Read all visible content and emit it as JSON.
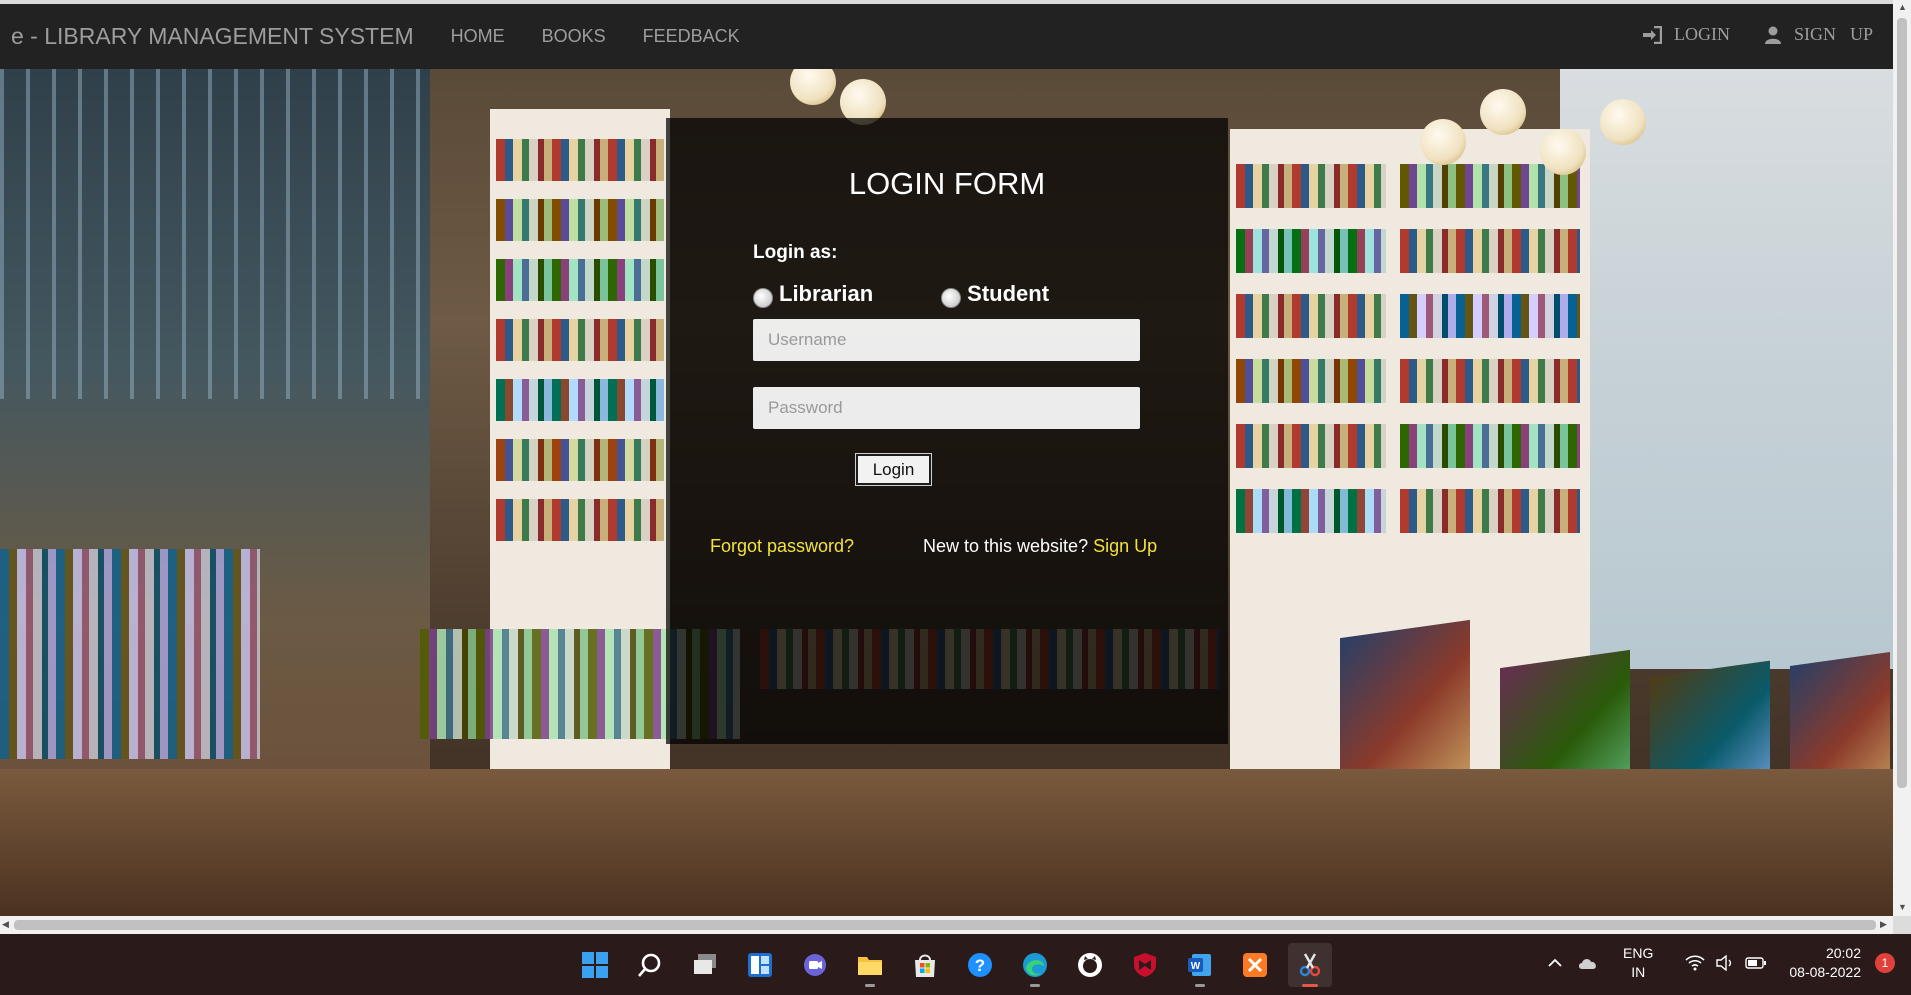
{
  "navbar": {
    "brand": "e - LIBRARY MANAGEMENT SYSTEM",
    "links": [
      "HOME",
      "BOOKS",
      "FEEDBACK"
    ],
    "login_label": "LOGIN",
    "signup_word1": "SIGN",
    "signup_word2": "UP"
  },
  "login_form": {
    "title": "LOGIN FORM",
    "login_as_label": "Login as:",
    "roles": [
      "Librarian",
      "Student"
    ],
    "username_placeholder": "Username",
    "password_placeholder": "Password",
    "submit_label": "Login",
    "forgot_password": "Forgot password?",
    "new_user_text": "New to this website?",
    "signup_link": "Sign Up"
  },
  "colors": {
    "navbar_bg": "#222222",
    "nav_text": "#9d9d9d",
    "link_yellow": "#f2e33a",
    "panel_bg": "rgba(0,0,0,0.72)",
    "taskbar_bg": "#2b1a1a"
  },
  "taskbar": {
    "icons": [
      "windows-start-icon",
      "search-icon",
      "task-view-icon",
      "widgets-icon",
      "teams-chat-icon",
      "file-explorer-icon",
      "microsoft-store-icon",
      "help-icon",
      "edge-browser-icon",
      "github-icon",
      "mcafee-icon",
      "word-icon",
      "xampp-icon",
      "snipping-tool-icon"
    ],
    "lang_line1": "ENG",
    "lang_line2": "IN",
    "time": "20:02",
    "date": "08-08-2022",
    "notification_count": "1"
  }
}
